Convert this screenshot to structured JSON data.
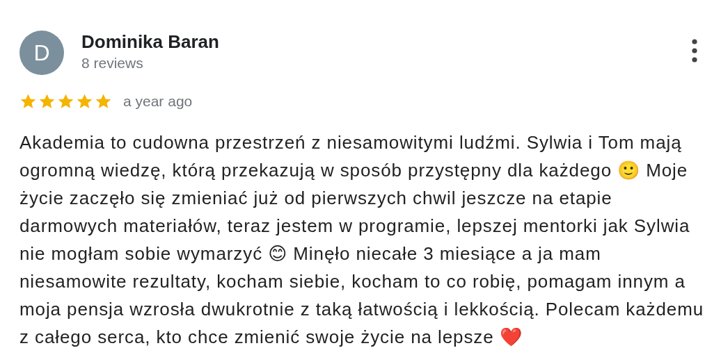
{
  "review": {
    "avatar_letter": "D",
    "author": "Dominika Baran",
    "author_meta": "8 reviews",
    "stars": 5,
    "time": "a year ago",
    "text": "Akademia to cudowna przestrzeń z niesamowitymi ludźmi. Sylwia i Tom mają ogromną wiedzę, którą przekazują w sposób przystępny dla każdego 🙂 Moje życie zaczęło się zmieniać już od pierwszych chwil jeszcze na etapie darmowych materiałów, teraz jestem w programie, lepszej mentorki jak Sylwia nie mogłam sobie wymarzyć 😊 Minęło niecałe 3 miesiące a ja mam niesamowite rezultaty, kocham siebie, kocham to co robię, pomagam innym a moja pensja wzrosła dwukrotnie z taką łatwością i lekkością. Polecam każdemu z całego serca, kto chce zmienić swoje życie na lepsze ❤️"
  }
}
